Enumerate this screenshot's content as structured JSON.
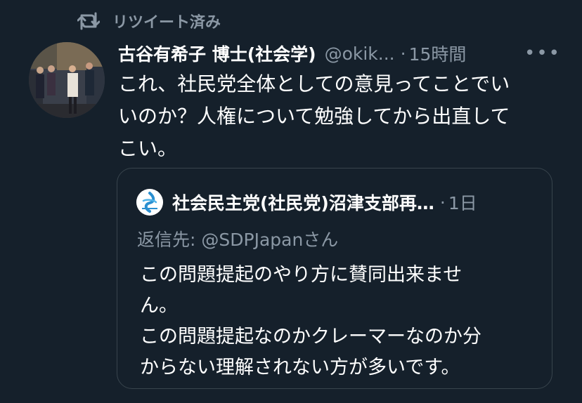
{
  "retweet": {
    "icon": "retweet-icon",
    "label": "リツイート済み"
  },
  "tweet": {
    "author_name": "古谷有希子 博士(社会学)",
    "handle": "@okik...",
    "separator": "·",
    "time": "15時間",
    "more_icon": "more-icon",
    "more_label": "•••",
    "body_lines": [
      "これ、社民党全体としての意見ってことでい",
      "いのか？人権について勉強してから出直して",
      "こい。"
    ]
  },
  "quote": {
    "author_name": "社会民主党(社民党)沼津支部再…",
    "separator": "·",
    "time": "1日",
    "reply_to": "返信先: @SDPJapanさん",
    "body_lines": [
      "この問題提起のやり方に賛同出来ませ",
      "ん。",
      "この問題提起なのかクレーマーなのか分",
      "からない理解されない方が多いです。"
    ]
  },
  "colors": {
    "background": "#15202b",
    "secondary_text": "#8b98a5",
    "border": "#38444d",
    "primary_text": "#ffffff"
  }
}
